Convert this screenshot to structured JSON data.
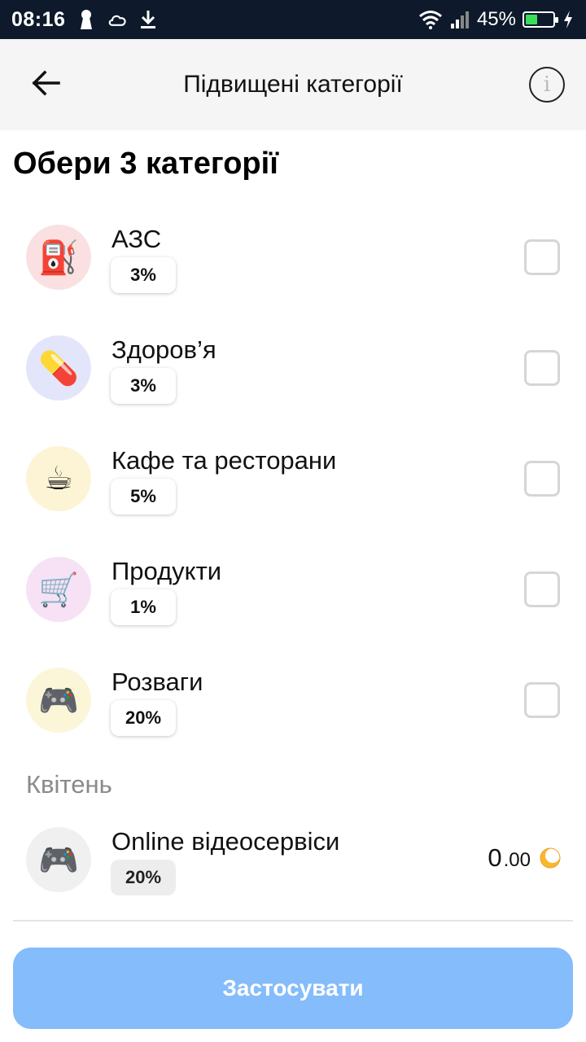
{
  "status_bar": {
    "time": "08:16",
    "battery_percent": "45%",
    "battery_level": 0.45,
    "icons": [
      "keyhole-icon",
      "cloud-icon",
      "download-icon",
      "wifi-icon",
      "signal-icon",
      "battery-icon",
      "charging-icon"
    ]
  },
  "app_bar": {
    "title": "Підвищені категорії",
    "back_icon": "arrow-left-icon",
    "info_label": "i"
  },
  "heading": "Обери 3 категорії",
  "categories": [
    {
      "name": "АЗС",
      "percent": "3%",
      "icon": "fuel-pump-icon",
      "glyph": "⛽",
      "bg": "#fbe0e2",
      "checked": false
    },
    {
      "name": "Здоров’я",
      "percent": "3%",
      "icon": "pill-icon",
      "glyph": "💊",
      "bg": "#e3e5fb",
      "checked": false
    },
    {
      "name": "Кафе та ресторани",
      "percent": "5%",
      "icon": "coffee-icon",
      "glyph": "☕",
      "bg": "#fdf4d6",
      "checked": false
    },
    {
      "name": "Продукти",
      "percent": "1%",
      "icon": "shopping-cart-icon",
      "glyph": "🛒",
      "bg": "#f6e1f5",
      "checked": false
    },
    {
      "name": "Розваги",
      "percent": "20%",
      "icon": "gamepad-icon",
      "glyph": "🎮",
      "bg": "#fbf6d8",
      "checked": false
    }
  ],
  "month": {
    "label": "Квітень",
    "item": {
      "name": "Online відеосервіси",
      "percent": "20%",
      "icon": "gamepad-icon",
      "glyph": "🎮",
      "cashback_int": "0",
      "cashback_dec": ".00",
      "coin_icon": "coin-icon"
    }
  },
  "apply_button": "Застосувати",
  "colors": {
    "status_bar_bg": "#0e1a2b",
    "apply_button_bg": "#85bcfb",
    "coin": "#f7b731",
    "battery_fill": "#3ddc5b"
  }
}
